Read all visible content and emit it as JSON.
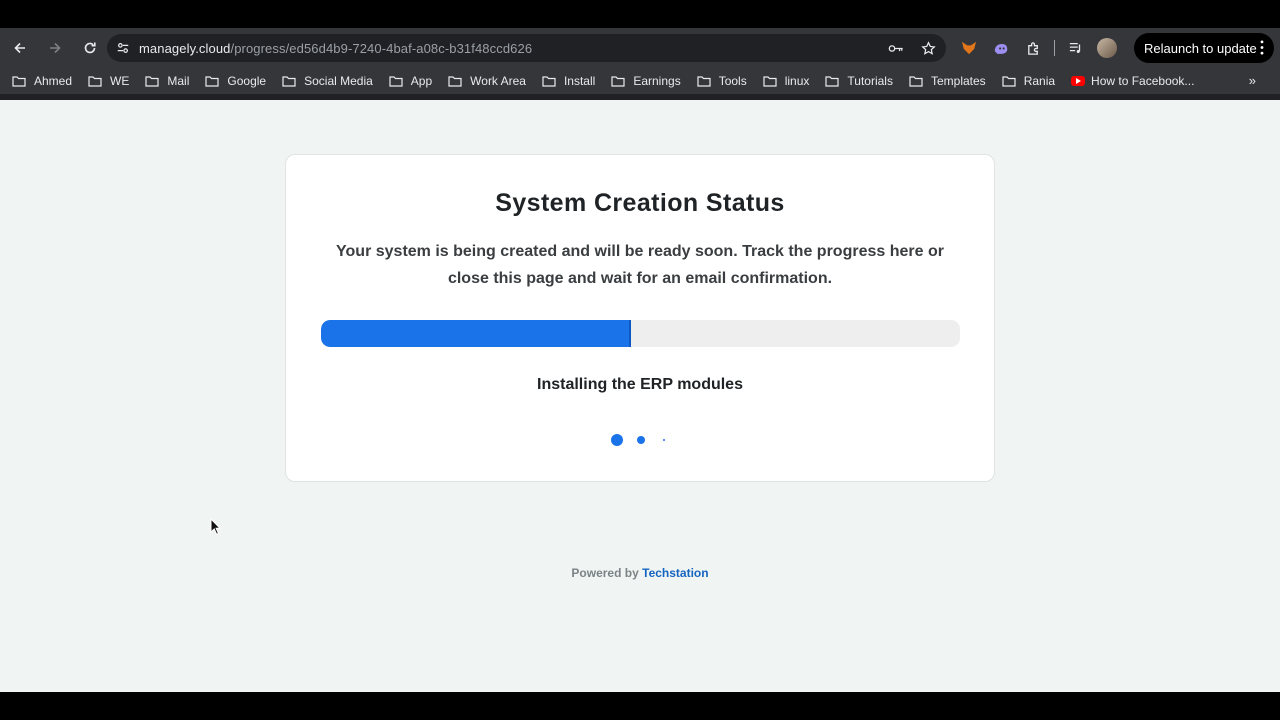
{
  "browser": {
    "url_host": "managely.cloud",
    "url_path": "/progress/ed56d4b9-7240-4baf-a08c-b31f48ccd626",
    "relaunch_label": "Relaunch to update",
    "bookmarks": [
      {
        "label": "Ahmed",
        "type": "folder"
      },
      {
        "label": "WE",
        "type": "folder"
      },
      {
        "label": "Mail",
        "type": "folder"
      },
      {
        "label": "Google",
        "type": "folder"
      },
      {
        "label": "Social Media",
        "type": "folder"
      },
      {
        "label": "App",
        "type": "folder"
      },
      {
        "label": "Work Area",
        "type": "folder"
      },
      {
        "label": "Install",
        "type": "folder"
      },
      {
        "label": "Earnings",
        "type": "folder"
      },
      {
        "label": "Tools",
        "type": "folder"
      },
      {
        "label": "linux",
        "type": "folder"
      },
      {
        "label": "Tutorials",
        "type": "folder"
      },
      {
        "label": "Templates",
        "type": "folder"
      },
      {
        "label": "Rania",
        "type": "folder"
      },
      {
        "label": "How to Facebook...",
        "type": "youtube"
      }
    ],
    "more_bookmarks": "»"
  },
  "card": {
    "title": "System Creation Status",
    "description": "Your system is being created and will be ready soon. Track the progress here or close this page and wait for an email confirmation.",
    "progress_percent": 48.5,
    "progress_color": "#1a73e8",
    "status_text": "Installing the ERP modules"
  },
  "footer": {
    "powered_prefix": "Powered by",
    "brand": "Techstation"
  }
}
